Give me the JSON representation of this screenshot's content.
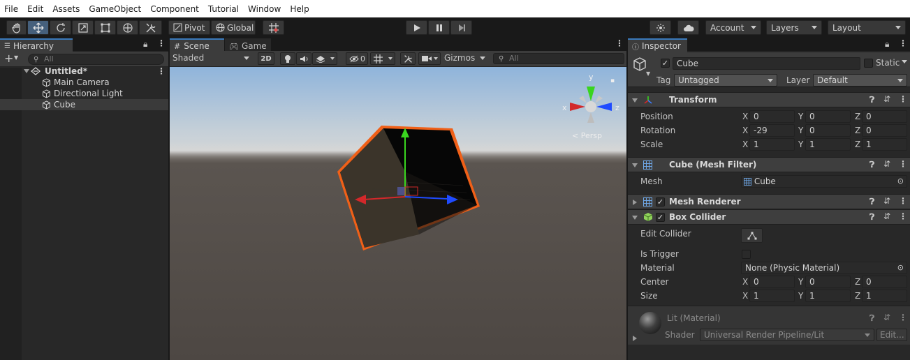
{
  "menu": [
    "File",
    "Edit",
    "Assets",
    "GameObject",
    "Component",
    "Tutorial",
    "Window",
    "Help"
  ],
  "toolbar": {
    "tools": [
      "hand-tool",
      "move-tool",
      "rotate-tool",
      "scale-tool",
      "rect-tool",
      "transform-tool",
      "custom-tool"
    ],
    "pivot_label": "Pivot",
    "global_label": "Global",
    "account_label": "Account",
    "layers_label": "Layers",
    "layout_label": "Layout"
  },
  "hierarchy": {
    "tab_label": "Hierarchy",
    "search_placeholder": "All",
    "scene_name": "Untitled*",
    "items": [
      "Main Camera",
      "Directional Light",
      "Cube"
    ]
  },
  "scene": {
    "tab_scene": "Scene",
    "tab_game": "Game",
    "shading_mode": "Shaded",
    "mode_2d": "2D",
    "hidden_count": "0",
    "gizmos_label": "Gizmos",
    "search_placeholder": "All",
    "persp_label": "< Persp",
    "axis_y": "y",
    "axis_x": "x",
    "axis_z": "z"
  },
  "inspector": {
    "tab_label": "Inspector",
    "object_name": "Cube",
    "static_label": "Static",
    "tag_label": "Tag",
    "tag_value": "Untagged",
    "layer_label": "Layer",
    "layer_value": "Default",
    "transform": {
      "title": "Transform",
      "position_label": "Position",
      "rotation_label": "Rotation",
      "scale_label": "Scale",
      "position": {
        "x": "0",
        "y": "0",
        "z": "0"
      },
      "rotation": {
        "x": "-29",
        "y": "0",
        "z": "0"
      },
      "scale": {
        "x": "1",
        "y": "1",
        "z": "1"
      }
    },
    "mesh_filter": {
      "title": "Cube (Mesh Filter)",
      "mesh_label": "Mesh",
      "mesh_value": "Cube"
    },
    "mesh_renderer": {
      "title": "Mesh Renderer"
    },
    "box_collider": {
      "title": "Box Collider",
      "edit_collider_label": "Edit Collider",
      "is_trigger_label": "Is Trigger",
      "material_label": "Material",
      "material_value": "None (Physic Material)",
      "center_label": "Center",
      "size_label": "Size",
      "center": {
        "x": "0",
        "y": "0",
        "z": "0"
      },
      "size": {
        "x": "1",
        "y": "1",
        "z": "1"
      }
    },
    "material": {
      "title": "Lit (Material)",
      "shader_label": "Shader",
      "shader_value": "Universal Render Pipeline/Lit",
      "edit_label": "Edit..."
    },
    "axis_x": "X",
    "axis_y": "Y",
    "axis_z": "Z"
  },
  "colors": {
    "accent": "#3a79bb",
    "selection_outline": "#f06018",
    "gizmo_x": "#d3282a",
    "gizmo_y": "#39d51f",
    "gizmo_z": "#1f4bff"
  }
}
